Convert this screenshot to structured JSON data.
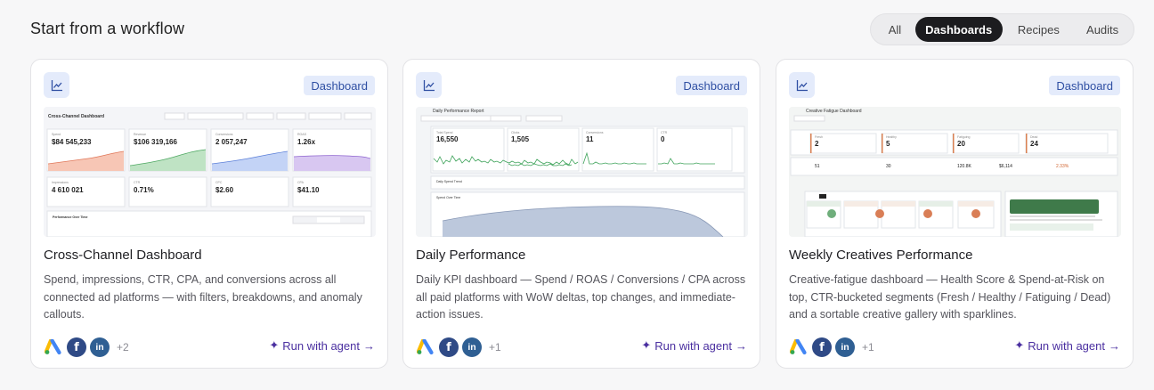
{
  "page": {
    "title": "Start from a workflow"
  },
  "filters": [
    {
      "label": "All",
      "active": false
    },
    {
      "label": "Dashboards",
      "active": true
    },
    {
      "label": "Recipes",
      "active": false
    },
    {
      "label": "Audits",
      "active": false
    }
  ],
  "cards": [
    {
      "type_tag": "Dashboard",
      "title": "Cross-Channel Dashboard",
      "description": "Spend, impressions, CTR, CPA, and conversions across all connected ad platforms — with filters, breakdowns, and anomaly callouts.",
      "platforms": [
        "google-ads-icon",
        "facebook-icon",
        "linkedin-icon"
      ],
      "more_count": "+2",
      "cta": "Run with agent",
      "preview": {
        "title": "Cross-Channel Dashboard",
        "kpis": [
          {
            "label": "Spend",
            "value": "$84 545,233",
            "delta": "+46.5%"
          },
          {
            "label": "Revenue",
            "value": "$106 319,166",
            "delta": "+62.8%"
          },
          {
            "label": "Conversions",
            "value": "2 057,247",
            "delta": "+30.9%"
          },
          {
            "label": "ROAS",
            "value": "1.26x",
            "delta": "-4.1%"
          },
          {
            "label": "Impressions",
            "value": "4 610 021",
            "delta": ""
          },
          {
            "label": "CTR",
            "value": "0.71%",
            "delta": ""
          },
          {
            "label": "CPC",
            "value": "$2.60",
            "delta": ""
          },
          {
            "label": "CPA",
            "value": "$41.10",
            "delta": ""
          }
        ],
        "section": "Performance Over Time",
        "toggles": [
          "Spend",
          "Revenue",
          "Conversions"
        ]
      }
    },
    {
      "type_tag": "Dashboard",
      "title": "Daily Performance",
      "description": "Daily KPI dashboard — Spend / ROAS / Conversions / CPA across all paid platforms with WoW deltas, top changes, and immediate-action issues.",
      "platforms": [
        "google-ads-icon",
        "facebook-icon",
        "linkedin-icon"
      ],
      "more_count": "+1",
      "cta": "Run with agent",
      "preview": {
        "title": "Daily Performance Report",
        "kpis": [
          {
            "label": "Total Spend",
            "value": "16,550"
          },
          {
            "label": "Clicks",
            "value": "1,505"
          },
          {
            "label": "Conversions",
            "value": "11"
          },
          {
            "label": "CTR",
            "value": "0"
          }
        ],
        "section_1": "Daily Spend Trend",
        "section_2": "Spend Over Time"
      }
    },
    {
      "type_tag": "Dashboard",
      "title": "Weekly Creatives Performance",
      "description": "Creative-fatigue dashboard — Health Score & Spend-at-Risk on top, CTR-bucketed segments (Fresh / Healthy / Fatiguing / Dead) and a sortable creative gallery with sparklines.",
      "platforms": [
        "google-ads-icon",
        "facebook-icon",
        "linkedin-icon"
      ],
      "more_count": "+1",
      "cta": "Run with agent",
      "preview": {
        "title": "Creative Fatigue Dashboard",
        "segments": [
          {
            "label": "Fresh",
            "value": "2"
          },
          {
            "label": "Healthy",
            "value": "5"
          },
          {
            "label": "Fatiguing",
            "value": "20"
          },
          {
            "label": "Dead",
            "value": "24"
          }
        ],
        "stats": [
          "51",
          "30",
          "120.8K",
          "$6,114",
          "2.33%"
        ]
      }
    }
  ],
  "colors": {
    "accent": "#4a2fa0",
    "tag_bg": "#e4ebfb",
    "tag_text": "#2f4fa3",
    "active_tab": "#1c1c1f"
  }
}
